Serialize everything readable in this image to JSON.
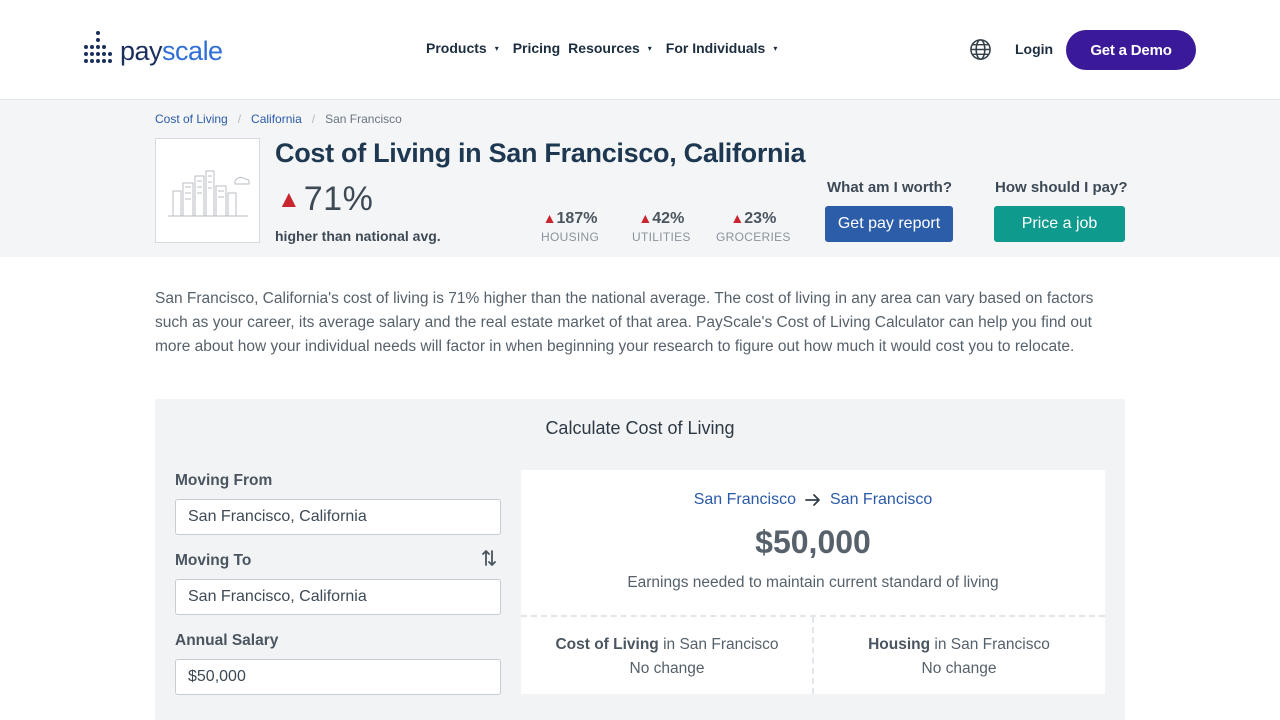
{
  "header": {
    "logo_pay": "pay",
    "logo_scale": "scale",
    "nav": [
      {
        "label": "Products",
        "has_caret": true
      },
      {
        "label": "Pricing",
        "has_caret": false
      },
      {
        "label": "Resources",
        "has_caret": true
      },
      {
        "label": "For Individuals",
        "has_caret": true
      }
    ],
    "caret_glyph": "▾",
    "login_label": "Login",
    "demo_label": "Get a Demo",
    "globe_icon": "globe-icon"
  },
  "breadcrumb": {
    "items": [
      "Cost of Living",
      "California",
      "San Francisco"
    ],
    "separator": "/"
  },
  "hero": {
    "title": "Cost of Living in San Francisco, California",
    "overall_pct": "71%",
    "overall_label": "higher than national avg.",
    "arrow": "▲",
    "stats": [
      {
        "value": "187%",
        "label": "HOUSING"
      },
      {
        "value": "42%",
        "label": "UTILITIES"
      },
      {
        "value": "23%",
        "label": "GROCERIES"
      }
    ],
    "cta_worth_label": "What am I worth?",
    "cta_worth_button": "Get pay report",
    "cta_pay_label": "How should I pay?",
    "cta_pay_button": "Price a job"
  },
  "description": "San Francisco, California's cost of living is 71% higher than the national average. The cost of living in any area can vary based on factors such as your career, its average salary and the real estate market of that area. PayScale's Cost of Living Calculator can help you find out more about how your individual needs will factor in when beginning your research to figure out how much it would cost you to relocate.",
  "calculator": {
    "title": "Calculate Cost of Living",
    "moving_from_label": "Moving From",
    "moving_from_value": "San Francisco, California",
    "moving_to_label": "Moving To",
    "moving_to_value": "San Francisco, California",
    "salary_label": "Annual Salary",
    "salary_value": "$50,000",
    "result": {
      "from_city": "San Francisco",
      "to_city": "San Francisco",
      "amount": "$50,000",
      "earnings_text": "Earnings needed to maintain current standard of living",
      "col_strong": "Cost of Living",
      "col_in": "in San Francisco",
      "col_value": "No change",
      "housing_strong": "Housing",
      "housing_in": "in San Francisco",
      "housing_value": "No change"
    }
  },
  "colors": {
    "brand_navy": "#1a2f5c",
    "brand_blue": "#2f6fd6",
    "demo_purple": "#3b1a9a",
    "up_red": "#c8252f",
    "button_blue": "#2c5da8",
    "button_teal": "#0f9a8e"
  }
}
